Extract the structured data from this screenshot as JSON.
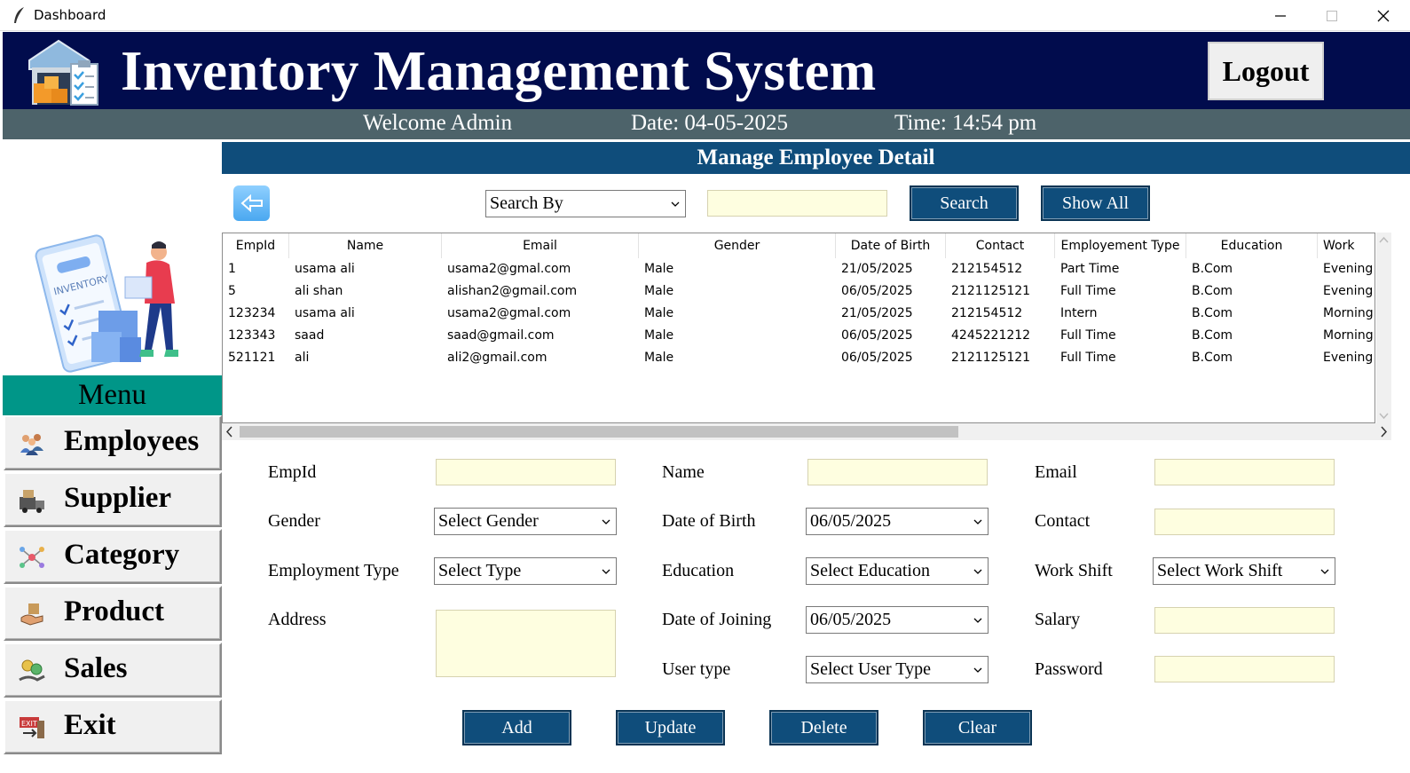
{
  "window": {
    "title": "Dashboard"
  },
  "header": {
    "title": "Inventory Management System",
    "logout_label": "Logout"
  },
  "subheader": {
    "welcome": "Welcome Admin",
    "date": "Date: 04-05-2025",
    "time": "Time: 14:54 pm"
  },
  "sidebar": {
    "menu_title": "Menu",
    "items": [
      {
        "label": "Employees",
        "icon": "employees-icon"
      },
      {
        "label": "Supplier",
        "icon": "supplier-icon"
      },
      {
        "label": "Category",
        "icon": "category-icon"
      },
      {
        "label": "Product",
        "icon": "product-icon"
      },
      {
        "label": "Sales",
        "icon": "sales-icon"
      },
      {
        "label": "Exit",
        "icon": "exit-icon"
      }
    ]
  },
  "main": {
    "section_title": "Manage Employee Detail",
    "search": {
      "by_value": "Search By",
      "query": "",
      "search_label": "Search",
      "show_all_label": "Show All"
    },
    "table": {
      "columns": [
        "EmpId",
        "Name",
        "Email",
        "Gender",
        "Date of Birth",
        "Contact",
        "Employement Type",
        "Education",
        "Work"
      ],
      "rows": [
        [
          "1",
          "usama ali",
          "usama2@gmal.com",
          "Male",
          "21/05/2025",
          "212154512",
          "Part Time",
          "B.Com",
          "Evening"
        ],
        [
          "5",
          "ali shan",
          "alishan2@gmail.com",
          "Male",
          "06/05/2025",
          "2121125121",
          "Full Time",
          "B.Com",
          "Evening"
        ],
        [
          "123234",
          "usama ali",
          "usama2@gmal.com",
          "Male",
          "21/05/2025",
          "212154512",
          "Intern",
          "B.Com",
          "Morning"
        ],
        [
          "123343",
          "saad",
          "saad@gmail.com",
          "Male",
          "06/05/2025",
          "4245221212",
          "Full Time",
          "B.Com",
          "Morning"
        ],
        [
          "521121",
          "ali",
          "ali2@gmail.com",
          "Male",
          "06/05/2025",
          "2121125121",
          "Full Time",
          "B.Com",
          "Evening"
        ]
      ]
    },
    "form": {
      "empid_label": "EmpId",
      "empid_value": "",
      "name_label": "Name",
      "name_value": "",
      "email_label": "Email",
      "email_value": "",
      "gender_label": "Gender",
      "gender_value": "Select Gender",
      "dob_label": "Date of Birth",
      "dob_value": "06/05/2025",
      "contact_label": "Contact",
      "contact_value": "",
      "employment_label": "Employment Type",
      "employment_value": "Select Type",
      "education_label": "Education",
      "education_value": "Select Education",
      "workshift_label": "Work Shift",
      "workshift_value": "Select Work Shift",
      "address_label": "Address",
      "address_value": "",
      "doj_label": "Date of Joining",
      "doj_value": "06/05/2025",
      "salary_label": "Salary",
      "salary_value": "",
      "usertype_label": "User type",
      "usertype_value": "Select User Type",
      "password_label": "Password",
      "password_value": ""
    },
    "actions": {
      "add": "Add",
      "update": "Update",
      "delete": "Delete",
      "clear": "Clear"
    }
  },
  "colors": {
    "header_bg": "#010c4d",
    "subheader_bg": "#4d636a",
    "accent_blue": "#0f4d7b",
    "menu_teal": "#009688",
    "input_bg": "#fefee0"
  }
}
